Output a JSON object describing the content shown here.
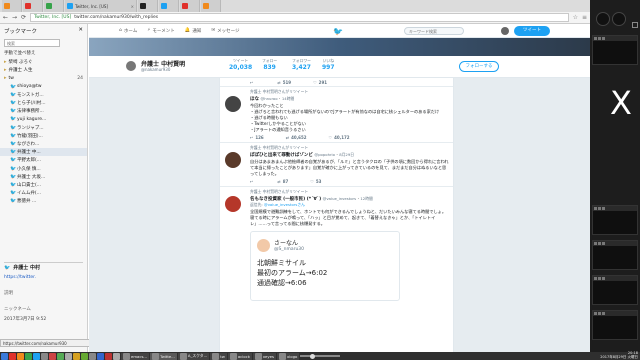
{
  "browser": {
    "tabs": [
      {
        "label": "",
        "color": "orange"
      },
      {
        "label": "",
        "color": "red"
      },
      {
        "label": "",
        "color": "green"
      },
      {
        "label": "Twitter, Inc. [US]",
        "color": "blue"
      },
      {
        "label": "",
        "color": "black"
      },
      {
        "label": "",
        "color": "blue"
      },
      {
        "label": "",
        "color": "red"
      },
      {
        "label": "",
        "color": "orange"
      }
    ],
    "active_tab_label": "tw",
    "url_secure": "Twitter, Inc. [US]",
    "url": "twitter.com/nakamur930/with_replies"
  },
  "sidebar": {
    "title": "ブックマーク",
    "search_placeholder": "検索",
    "section_label": "手動で並べ替え",
    "items": [
      {
        "label": "柴崎 ぶろぐ",
        "icon": "folder",
        "count": ""
      },
      {
        "label": "弁護士 人生",
        "icon": "folder",
        "count": ""
      },
      {
        "label": "tw",
        "icon": "folder",
        "count": "24"
      },
      {
        "label": "shioya@tw",
        "icon": "bird",
        "count": ""
      },
      {
        "label": "モンストガ...",
        "icon": "bird",
        "count": ""
      },
      {
        "label": "とら子(川村...",
        "icon": "bird",
        "count": ""
      },
      {
        "label": "法律事務所...",
        "icon": "bird",
        "count": ""
      },
      {
        "label": "yuji kagure...",
        "icon": "bird",
        "count": ""
      },
      {
        "label": "ランジャプ...",
        "icon": "bird",
        "count": ""
      },
      {
        "label": "竹龍(羽田)...",
        "icon": "bird",
        "count": ""
      },
      {
        "label": "ながさわ...",
        "icon": "bird",
        "count": ""
      },
      {
        "label": "弁護士 中...",
        "icon": "bird",
        "count": ""
      },
      {
        "label": "平野太郎(...",
        "icon": "bird",
        "count": ""
      },
      {
        "label": "小久保 慎...",
        "icon": "bird",
        "count": ""
      },
      {
        "label": "弁護士 大坂...",
        "icon": "bird",
        "count": ""
      },
      {
        "label": "山口貴士(...",
        "icon": "bird",
        "count": ""
      },
      {
        "label": "イムム弁(...",
        "icon": "bird",
        "count": ""
      },
      {
        "label": "悪徳弁 ...",
        "icon": "bird",
        "count": ""
      }
    ],
    "detail": {
      "name": "弁護士 中村",
      "link": "https://twitter.",
      "desc_label": "説明",
      "keyword_label": "ニックネーム",
      "timestamp": "2017年3月7日 9:52"
    }
  },
  "statusbar_url": "https://twitter.com/nakamur930",
  "twitter": {
    "nav": [
      {
        "icon": "home-icon",
        "label": "ホーム"
      },
      {
        "icon": "moments-icon",
        "label": "モーメント"
      },
      {
        "icon": "bell-icon",
        "label": "通知"
      },
      {
        "icon": "mail-icon",
        "label": "メッセージ"
      }
    ],
    "search_placeholder": "キーワード検索",
    "tweet_button": "ツイート",
    "profile": {
      "name": "弁護士 中村賢明",
      "handle": "@nakamur930",
      "stats": [
        {
          "label": "ツイート",
          "value": "20,038"
        },
        {
          "label": "フォロー",
          "value": "839"
        },
        {
          "label": "フォロワー",
          "value": "3,427"
        },
        {
          "label": "いいね",
          "value": "997"
        }
      ],
      "follow_button": "フォローする"
    },
    "first_actions": {
      "reply": "",
      "retweet": "519",
      "like": "291"
    },
    "tweets": [
      {
        "rt_note": "弁護士 中村賢明さんがリツイート",
        "name": "ほな",
        "handle": "@hnuroo",
        "time": "14時間",
        "text": "今回わかったこと\n・逃げろと言われても逃げる場所がないのでJアラートが有効なのは自宅に核シェルターのある家だけ\n・逃げる時間もない\n・Twitterしかやることがない\n・Jアラートの通知音うるさい",
        "actions": {
          "reply": "126",
          "retweet": "40,652",
          "like": "40,172"
        }
      },
      {
        "rt_note": "弁護士 中村賢明さんがリツイート",
        "name": "ぽぽひと出来て罪動けばゾンビ",
        "handle": "@popohrio",
        "time": "8月29日",
        "text": "自分はあまあまんぷ他絵師者の自覚があるが、「ルミ」と言うタクロの「子供の頃に数回から得れに言われて本当に帰ったことがあります」自覚が確かに上がってきているのを見て、まだまだ自分はぬるいなと思ってしまった。",
        "actions": {
          "reply": "",
          "retweet": "87",
          "like": "53"
        }
      },
      {
        "rt_note": "弁護士 中村賢明さんがリツイート",
        "name": "名もなき投資家 (一般市民) (*´∀`)",
        "handle": "@value_investors",
        "time": "12時間",
        "reply_to_prefix": "返信先:",
        "reply_to_handle": "@value_investorsさん",
        "text": "全国規模で避難訓練をして、ホントでも何ができるんでしょうねと、だいたいみんな寝てる時間でしょ。寝てる時にアラームが鳴って、「ハッ」と目が覚めて、起きて、「着替えなきゃ」とか、「トイレトイレ」……って言ってる間に核爆発する。",
        "embed": {
          "name": "さーなん",
          "handle": "@S_nmaru30",
          "text": "北朝鮮ミサイル\n最初のアラーム→6:02\n通過確認→6:06"
        }
      }
    ]
  },
  "taskbar": {
    "items": [
      {
        "label": "emacs...",
        "active": false
      },
      {
        "label": "Twitte...",
        "active": true
      },
      {
        "label": "A_スクタ...",
        "active": false
      },
      {
        "label": "tw",
        "active": false
      },
      {
        "label": "aclock",
        "active": false
      },
      {
        "label": "xeyes",
        "active": false
      },
      {
        "label": "xlogo",
        "active": false
      }
    ],
    "clock_time": "20:18",
    "clock_date": "2017年8月29日 火曜日"
  },
  "colors": {
    "twitter_blue": "#1da1f2",
    "sidebar_selected": "#dfe6ee"
  }
}
